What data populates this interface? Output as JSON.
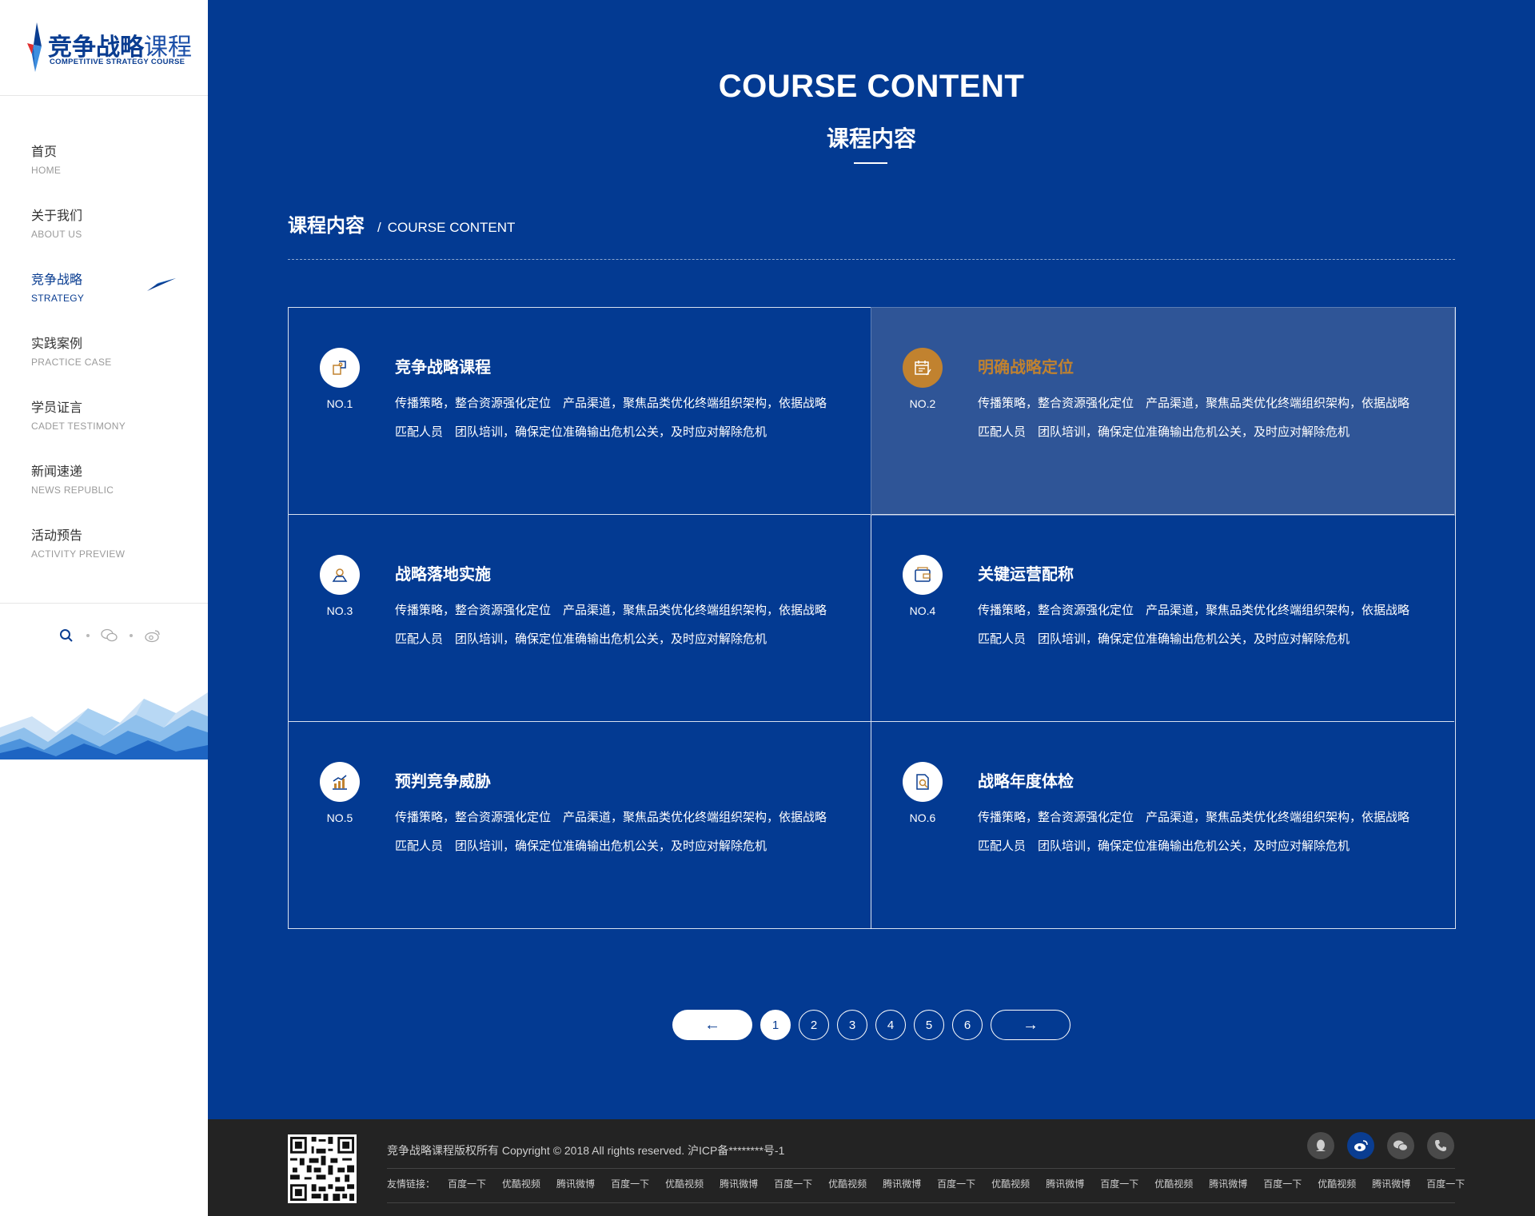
{
  "brand": {
    "name_cn_bold": "竞争战略",
    "name_cn_light": "课程",
    "name_en": "COMPETITIVE STRATEGY COURSE",
    "primary_color": "#033a92",
    "accent_color": "#c1822f"
  },
  "sidebar": {
    "items": [
      {
        "cn": "首页",
        "en": "HOME"
      },
      {
        "cn": "关于我们",
        "en": "ABOUT US"
      },
      {
        "cn": "竞争战略",
        "en": "STRATEGY",
        "active": true
      },
      {
        "cn": "实践案例",
        "en": "PRACTICE CASE"
      },
      {
        "cn": "学员证言",
        "en": "CADET TESTIMONY"
      },
      {
        "cn": "新闻速递",
        "en": "NEWS REPUBLIC"
      },
      {
        "cn": "活动预告",
        "en": "ACTIVITY PREVIEW"
      }
    ],
    "icons": [
      "search-icon",
      "wechat-icon",
      "weibo-icon"
    ]
  },
  "hero": {
    "title_en": "COURSE CONTENT",
    "title_cn": "课程内容"
  },
  "section": {
    "title_cn": "课程内容",
    "separator": "/",
    "title_en": "COURSE CONTENT"
  },
  "cards": [
    {
      "no": "NO.1",
      "title": "竞争战略课程",
      "desc": "传播策略，整合资源强化定位　产品渠道，聚焦品类优化终端组织架构，依据战略匹配人员　团队培训，确保定位准确输出危机公关，及时应对解除危机",
      "icon": "puzzle-icon"
    },
    {
      "no": "NO.2",
      "title": "明确战略定位",
      "desc": "传播策略，整合资源强化定位　产品渠道，聚焦品类优化终端组织架构，依据战略匹配人员　团队培训，确保定位准确输出危机公关，及时应对解除危机",
      "icon": "calendar-edit-icon"
    },
    {
      "no": "NO.3",
      "title": "战略落地实施",
      "desc": "传播策略，整合资源强化定位　产品渠道，聚焦品类优化终端组织架构，依据战略匹配人员　团队培训，确保定位准确输出危机公关，及时应对解除危机",
      "icon": "location-pin-icon"
    },
    {
      "no": "NO.4",
      "title": "关键运营配称",
      "desc": "传播策略，整合资源强化定位　产品渠道，聚焦品类优化终端组织架构，依据战略匹配人员　团队培训，确保定位准确输出危机公关，及时应对解除危机",
      "icon": "wallet-icon"
    },
    {
      "no": "NO.5",
      "title": "预判竞争威胁",
      "desc": "传播策略，整合资源强化定位　产品渠道，聚焦品类优化终端组织架构，依据战略匹配人员　团队培训，确保定位准确输出危机公关，及时应对解除危机",
      "icon": "chart-growth-icon"
    },
    {
      "no": "NO.6",
      "title": "战略年度体检",
      "desc": "传播策略，整合资源强化定位　产品渠道，聚焦品类优化终端组织架构，依据战略匹配人员　团队培训，确保定位准确输出危机公关，及时应对解除危机",
      "icon": "document-search-icon"
    }
  ],
  "pager": {
    "prev": "←",
    "next": "→",
    "pages": [
      "1",
      "2",
      "3",
      "4",
      "5",
      "6"
    ],
    "current": "1"
  },
  "footer": {
    "copyright": "竞争战略课程版权所有 Copyright © 2018 All rights reserved. 沪ICP备********号-1",
    "links_label": "友情链接：",
    "links": [
      "百度一下",
      "优酷视频",
      "腾讯微博",
      "百度一下",
      "优酷视频",
      "腾讯微博",
      "百度一下",
      "优酷视频",
      "腾讯微博",
      "百度一下",
      "优酷视频",
      "腾讯微博",
      "百度一下",
      "优酷视频",
      "腾讯微博",
      "百度一下",
      "优酷视频",
      "腾讯微博",
      "百度一下"
    ],
    "social": [
      "qq-icon",
      "weibo-icon",
      "wechat-icon",
      "phone-icon"
    ],
    "social_active": "weibo-icon"
  }
}
